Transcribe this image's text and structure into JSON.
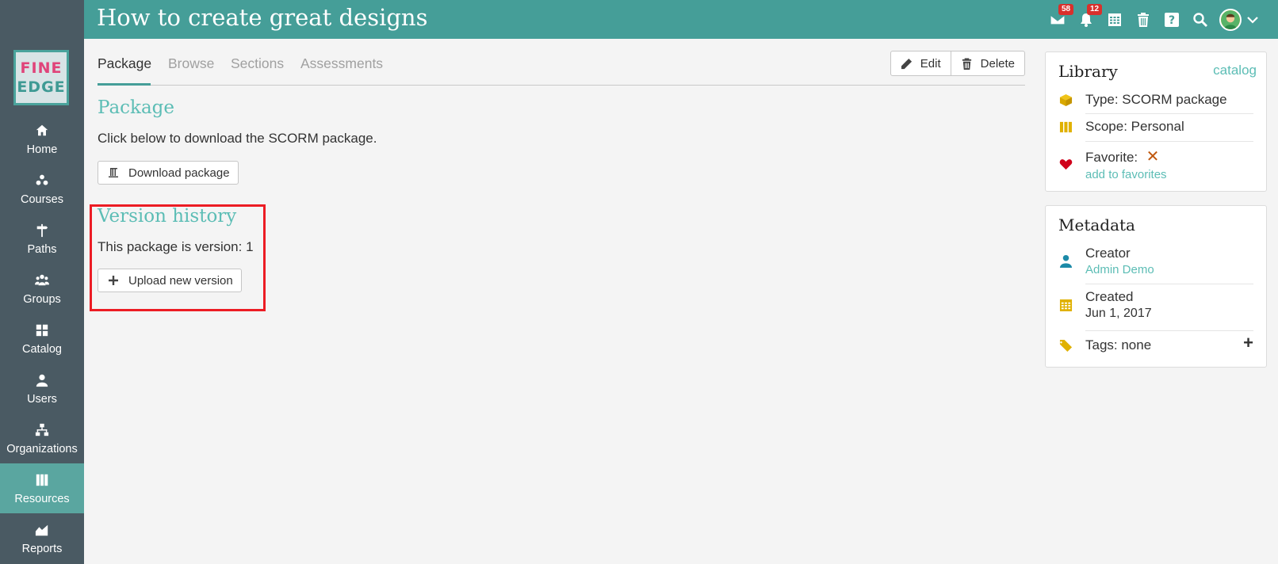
{
  "app": {
    "logo_line1": "FINE",
    "logo_line2": "EDGE",
    "page_title": "How to create great designs"
  },
  "topbar": {
    "messages_badge": "58",
    "notifications_badge": "12",
    "icons": [
      "envelope-icon",
      "bell-icon",
      "calendar-icon",
      "trash-icon",
      "help-icon",
      "search-icon",
      "avatar",
      "chevron-down-icon"
    ]
  },
  "sidebar": {
    "items": [
      {
        "label": "Home",
        "icon": "home-icon"
      },
      {
        "label": "Courses",
        "icon": "courses-icon"
      },
      {
        "label": "Paths",
        "icon": "signpost-icon"
      },
      {
        "label": "Groups",
        "icon": "group-icon"
      },
      {
        "label": "Catalog",
        "icon": "grid-icon"
      },
      {
        "label": "Users",
        "icon": "user-icon"
      },
      {
        "label": "Organizations",
        "icon": "org-icon"
      },
      {
        "label": "Resources",
        "icon": "books-icon",
        "active": true
      },
      {
        "label": "Reports",
        "icon": "chart-icon"
      }
    ]
  },
  "tabs": [
    {
      "label": "Package",
      "active": true
    },
    {
      "label": "Browse"
    },
    {
      "label": "Sections"
    },
    {
      "label": "Assessments"
    }
  ],
  "actions": {
    "edit_label": "Edit",
    "delete_label": "Delete"
  },
  "package": {
    "title": "Package",
    "description": "Click below to download the SCORM package.",
    "download_label": "Download package"
  },
  "version": {
    "title": "Version history",
    "text": "This package is version: 1",
    "upload_label": "Upload new version"
  },
  "library": {
    "title": "Library",
    "link": "catalog",
    "type": "Type: SCORM package",
    "scope": "Scope: Personal",
    "favorite": "Favorite:",
    "favorite_mark": "✕",
    "add_favorites": "add to favorites"
  },
  "metadata": {
    "title": "Metadata",
    "creator_label": "Creator",
    "creator_name": "Admin Demo",
    "created_label": "Created",
    "created_date": "Jun 1, 2017",
    "tags": "Tags: none",
    "add_tag": "+"
  },
  "colors": {
    "teal": "#459e98",
    "teal_text": "#5cbdb5",
    "sidebar": "#4a5a63",
    "highlight": "#ec1c24",
    "gold": "#e0b100",
    "heart": "#d0021b"
  }
}
